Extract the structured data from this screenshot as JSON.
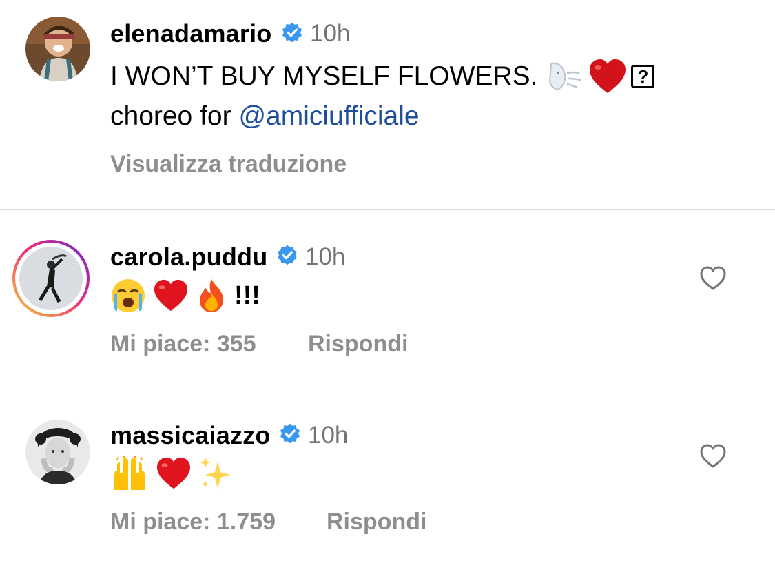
{
  "post": {
    "username": "elenadamario",
    "time": "10h",
    "caption_line1": "I WON’T BUY MYSELF FLOWERS.",
    "caption_line2_prefix": "choreo for ",
    "mention": "@amiciufficiale",
    "translate_label": "Visualizza traduzione",
    "emojis": [
      "wind-face-icon",
      "red-heart-icon",
      "unknown-glyph-icon"
    ],
    "unknown_glyph": "?"
  },
  "comments": [
    {
      "username": "carola.puddu",
      "time": "10h",
      "emojis": [
        "loudly-crying-face-icon",
        "red-heart-icon",
        "fire-icon"
      ],
      "suffix": "!!!",
      "likes_label": "Mi piace: 355",
      "reply_label": "Rispondi"
    },
    {
      "username": "massicaiazzo",
      "time": "10h",
      "emojis": [
        "raising-hands-icon",
        "red-heart-icon",
        "sparkles-icon"
      ],
      "likes_label": "Mi piace: 1.759",
      "reply_label": "Rispondi"
    }
  ],
  "colors": {
    "verified_blue": "#3897f0",
    "mention_blue": "#1f4f9a",
    "muted_gray": "#8e8e8e",
    "story_ring_start": "#f9ce34",
    "story_ring_mid": "#ee2a7b",
    "story_ring_end": "#6228d7"
  }
}
